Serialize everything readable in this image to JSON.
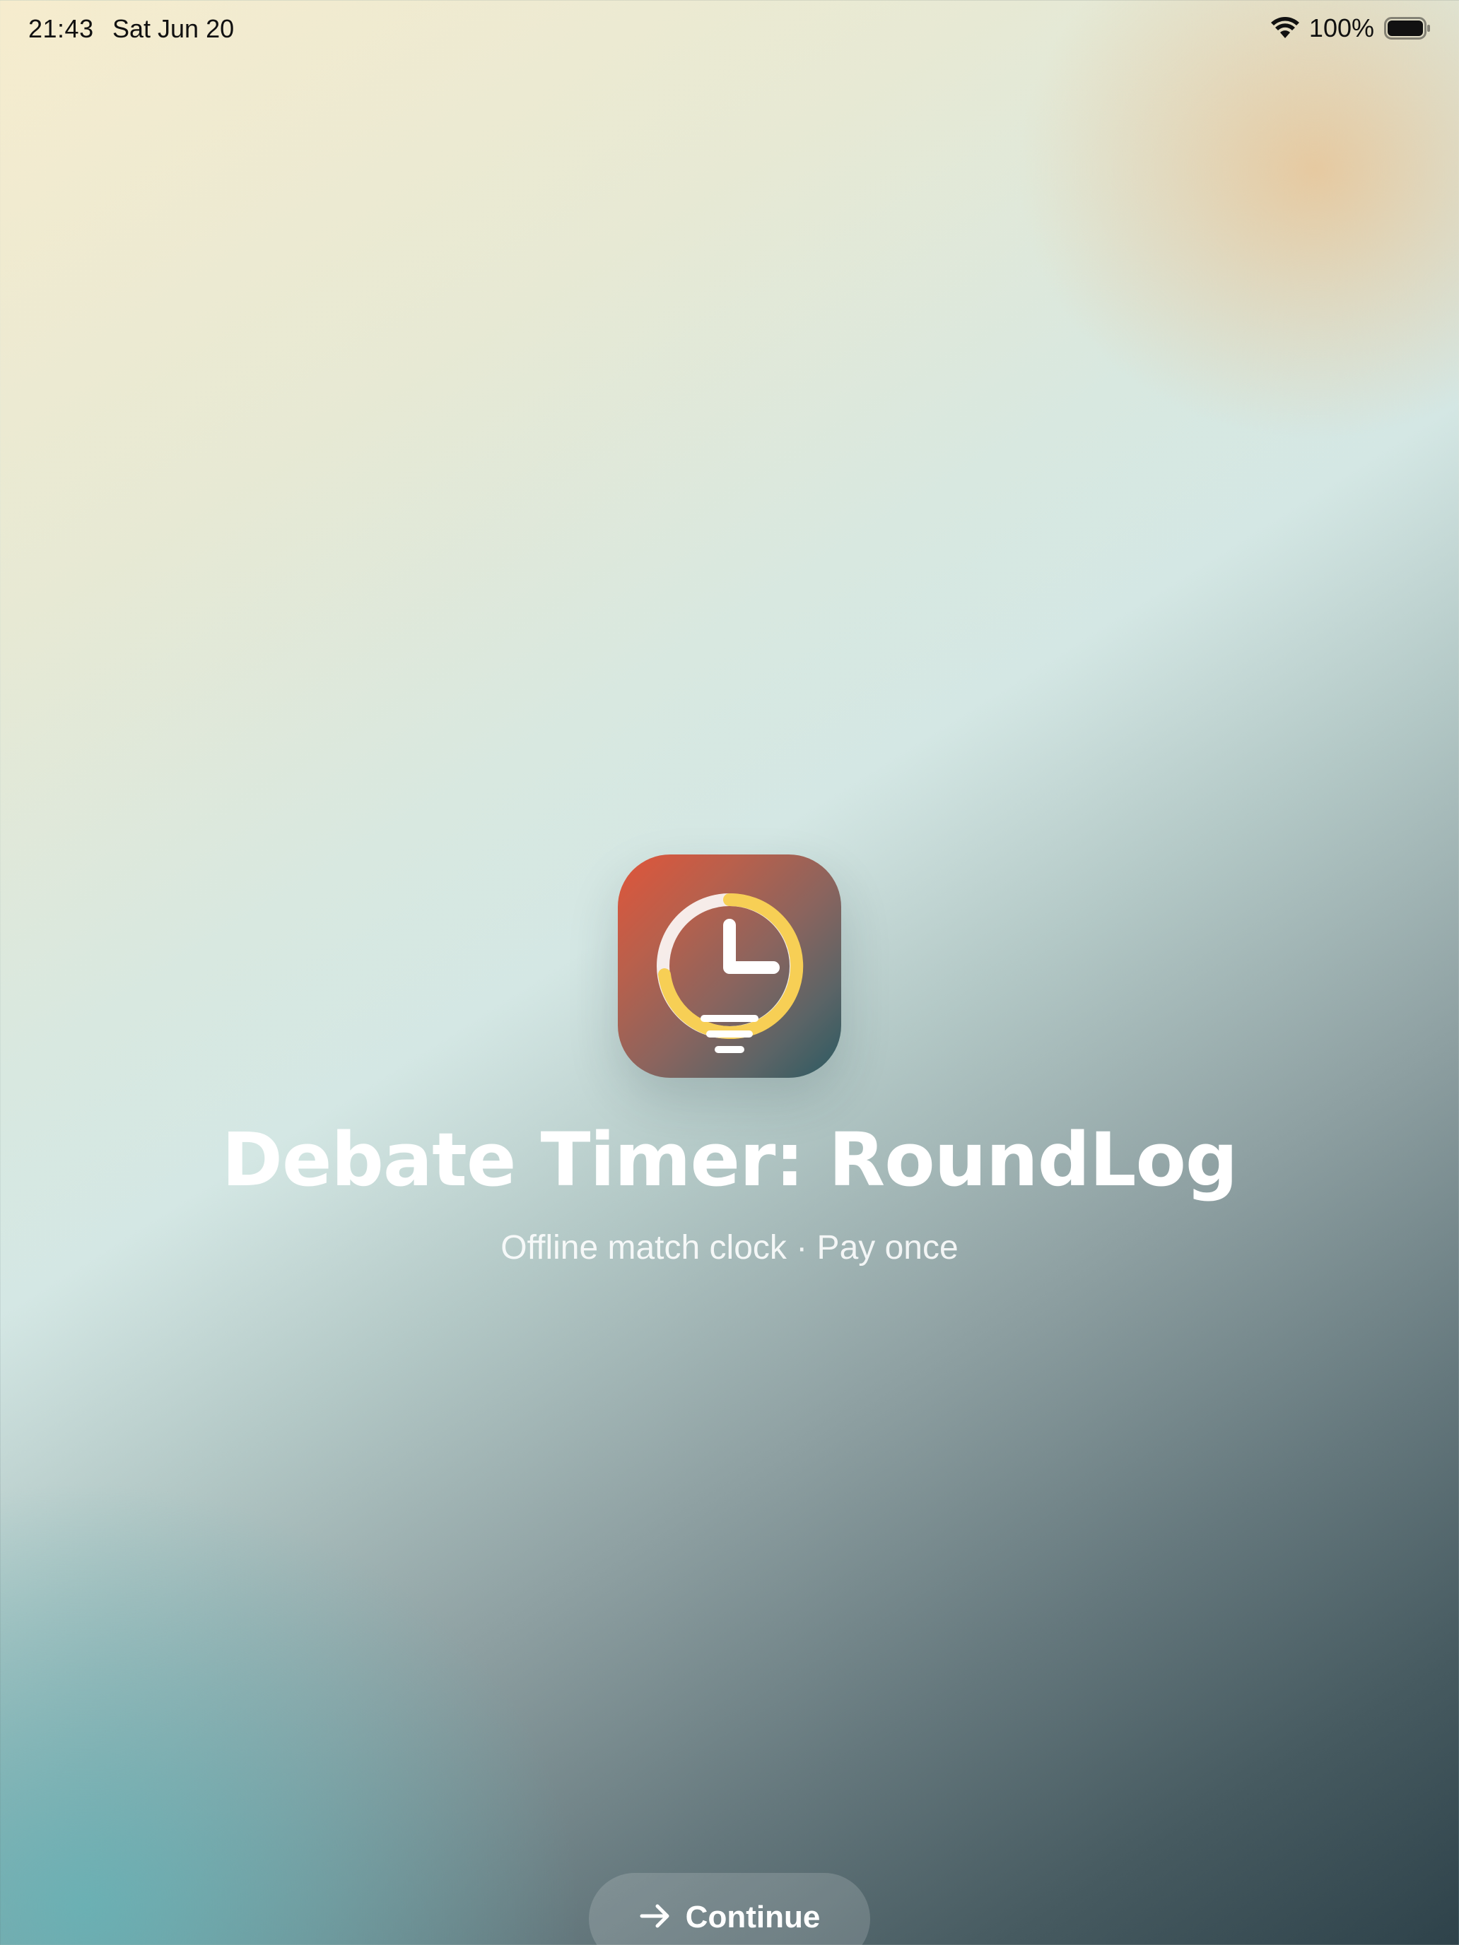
{
  "status_bar": {
    "time": "21:43",
    "date": "Sat Jun 20",
    "battery": "100%",
    "icons": [
      "wifi-icon",
      "battery-icon"
    ]
  },
  "app": {
    "icon": "clock-lightbulb-icon",
    "title": "Debate Timer: RoundLog",
    "subtitle": "Offline match clock · Pay once"
  },
  "continue_button": {
    "label": "Continue",
    "icon": "arrow-right-icon"
  },
  "colors": {
    "icon_orange": "#e0553a",
    "icon_teal": "#2b5a62",
    "ring_yellow": "#f7cf55",
    "text_white": "#ffffff"
  }
}
